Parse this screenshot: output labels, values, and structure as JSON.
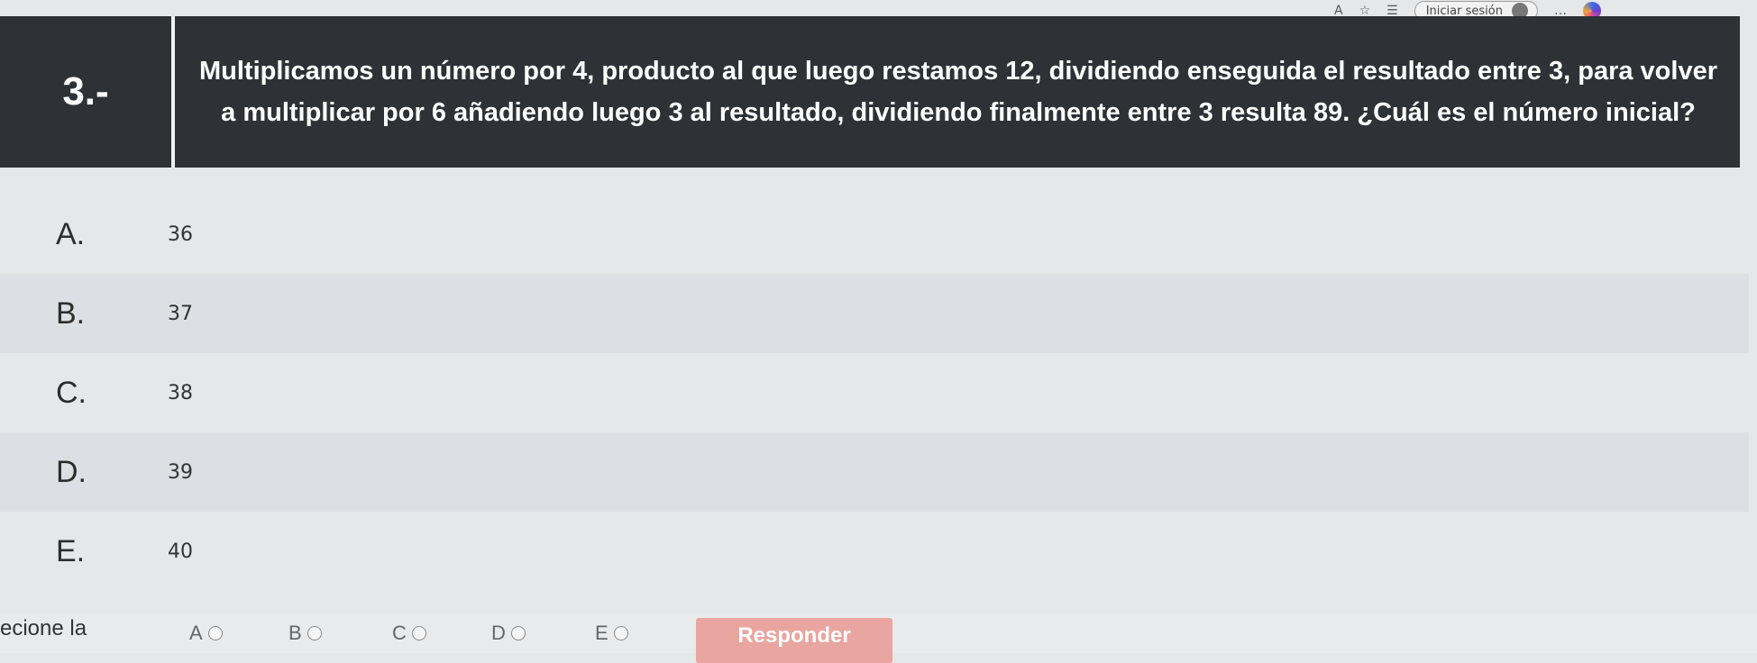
{
  "browser": {
    "font_size_icon": "A",
    "signin_label": "Iniciar sesión",
    "more_label": "…"
  },
  "question": {
    "number": "3.-",
    "text": "Multiplicamos un número por 4, producto al que luego restamos 12, dividiendo enseguida el resultado entre 3, para volver a multiplicar por 6 añadiendo luego 3 al resultado, dividiendo finalmente entre 3 resulta 89. ¿Cuál es el número inicial?"
  },
  "options": [
    {
      "letter": "A.",
      "value": "36"
    },
    {
      "letter": "B.",
      "value": "37"
    },
    {
      "letter": "C.",
      "value": "38"
    },
    {
      "letter": "D.",
      "value": "39"
    },
    {
      "letter": "E.",
      "value": "40"
    }
  ],
  "answer": {
    "label": "ecione la",
    "choices": [
      "A",
      "B",
      "C",
      "D",
      "E"
    ],
    "submit_label": "Responder"
  },
  "colors": {
    "header_bg": "#2e3236",
    "submit_bg": "#e9a5a0"
  }
}
